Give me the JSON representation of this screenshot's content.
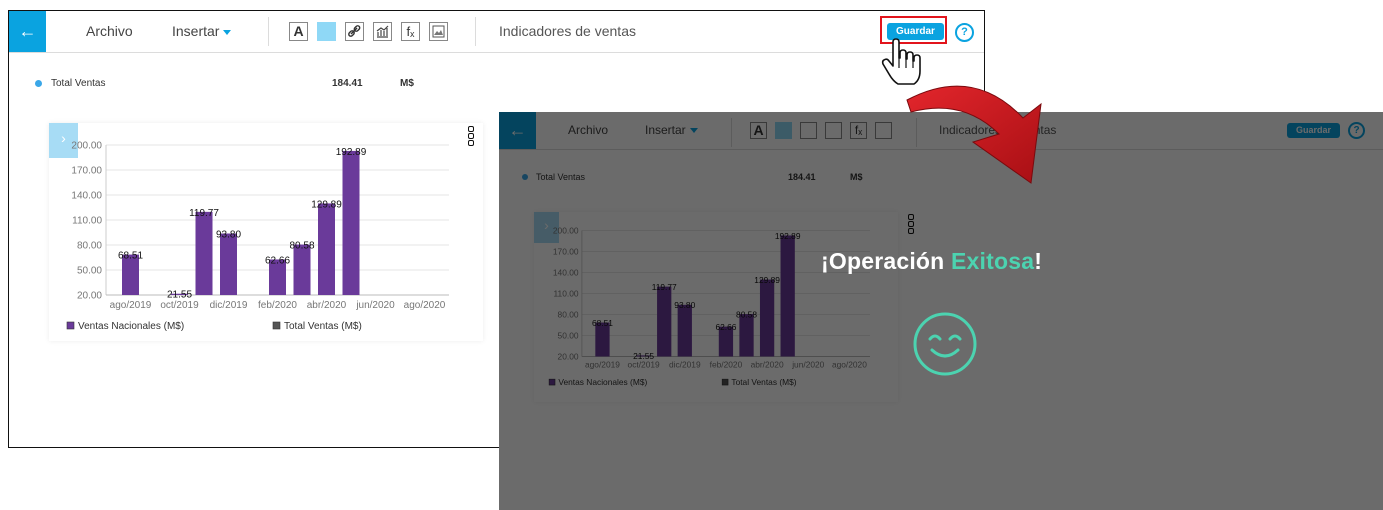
{
  "toolbar": {
    "back_glyph": "←",
    "menu_file": "Archivo",
    "menu_insert": "Insertar",
    "tools": [
      "text-style",
      "fill-color",
      "link",
      "chart",
      "formula",
      "image"
    ],
    "tool_text_glyph": "A",
    "tool_formula_glyph": "fₓ",
    "title": "Indicadores de ventas",
    "save_label": "Guardar",
    "help_glyph": "?"
  },
  "kpi": {
    "label": "Total Ventas",
    "value": "184.41",
    "unit": "M$"
  },
  "chart_expand_glyph": "›",
  "chart_data": {
    "type": "bar",
    "yticks": [
      "200.00",
      "170.00",
      "140.00",
      "110.00",
      "80.00",
      "50.00",
      "20.00"
    ],
    "ylim": [
      20,
      200
    ],
    "xticks": [
      "ago/2019",
      "oct/2019",
      "dic/2019",
      "feb/2020",
      "abr/2020",
      "jun/2020",
      "ago/2020"
    ],
    "bars": [
      {
        "x": "ago/2019",
        "value": 68.51,
        "label": "68.51"
      },
      {
        "x": "oct/2019",
        "value": 21.55,
        "label": "21.55"
      },
      {
        "x": "nov/2019",
        "value": 119.77,
        "label": "119.77"
      },
      {
        "x": "dic/2019",
        "value": 93.8,
        "label": "93.80"
      },
      {
        "x": "feb/2020",
        "value": 62.66,
        "label": "62.66"
      },
      {
        "x": "mar/2020",
        "value": 80.58,
        "label": "80.58"
      },
      {
        "x": "abr/2020",
        "value": 129.89,
        "label": "129.89"
      },
      {
        "x": "may/2020",
        "value": 192.89,
        "label": "192.89"
      }
    ],
    "legend": [
      {
        "name": "Ventas Nacionales (M$)",
        "color": "#6a3a9a"
      },
      {
        "name": "Total Ventas (M$)",
        "color": "#555555"
      }
    ],
    "bar_color": "#6a3a9a",
    "grid": true,
    "legend_position": "bottom"
  },
  "success": {
    "prefix": "¡Operación ",
    "accent": "Exitosa",
    "suffix": "!"
  },
  "colors": {
    "accent": "#0aa3e0",
    "success": "#4cd3b0",
    "highlight": "#e2141c",
    "arrow": "#c8141c"
  }
}
